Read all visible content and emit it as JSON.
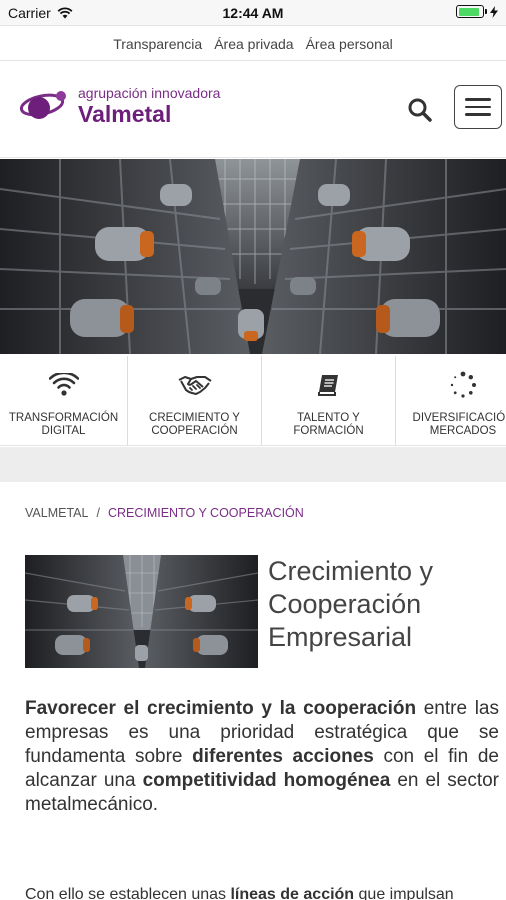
{
  "status_bar": {
    "carrier": "Carrier",
    "time": "12:44 AM",
    "battery_level": 0.9
  },
  "top_links": [
    "Transparencia",
    "Área privada",
    "Área personal"
  ],
  "header": {
    "logo_small": "agrupación innovadora",
    "logo_big": "Valmetal",
    "brand_color": "#6d1f7b"
  },
  "categories": [
    {
      "label": "TRANSFORMACIÓN\nDIGITAL",
      "icon": "wifi-icon"
    },
    {
      "label": "CRECIMIENTO Y\nCOOPERACIÓN",
      "icon": "handshake-icon"
    },
    {
      "label": "TALENTO Y\nFORMACIÓN",
      "icon": "book-icon"
    },
    {
      "label": "DIVERSIFICACIÓN\nMERCADOS",
      "icon": "dotted-circle-icon"
    }
  ],
  "breadcrumb": {
    "root": "VALMETAL",
    "separator": "/",
    "current": "CRECIMIENTO Y COOPERACIÓN"
  },
  "article": {
    "title": "Crecimiento y Cooperación Empresarial",
    "intro": [
      {
        "text": "Favorecer el crecimiento y la cooperación",
        "bold": true
      },
      {
        "text": " entre las empresas es una prioridad estratégica que se fundamenta sobre ",
        "bold": false
      },
      {
        "text": "diferentes acciones",
        "bold": true
      },
      {
        "text": " con el fin de alcanzar una ",
        "bold": false
      },
      {
        "text": "competitividad homogénea",
        "bold": true
      },
      {
        "text": " en el sector metalmecánico.",
        "bold": false
      }
    ],
    "next_para": [
      {
        "text": "Con ello se establecen unas ",
        "bold": false
      },
      {
        "text": "líneas de acción",
        "bold": true
      },
      {
        "text": " que impulsan",
        "bold": false
      }
    ]
  }
}
